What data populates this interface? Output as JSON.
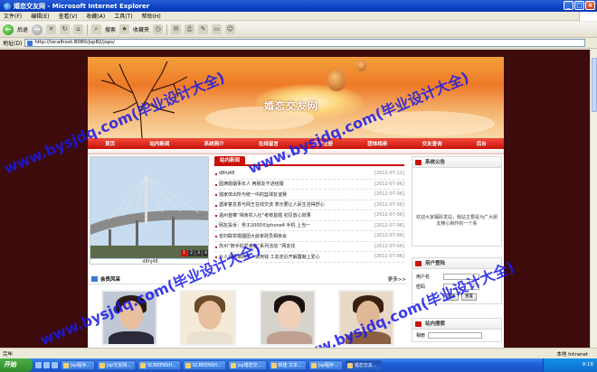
{
  "window": {
    "title": "婚恋交友网 - Microsoft Internet Explorer",
    "minimize": "_",
    "maximize": "□",
    "close": "×"
  },
  "menu": [
    "文件(F)",
    "编辑(E)",
    "查看(V)",
    "收藏(A)",
    "工具(T)",
    "帮助(H)"
  ],
  "toolbar": {
    "back_label": "后退",
    "search_label": "搜索",
    "favorites_label": "收藏夹"
  },
  "address": {
    "label": "地址(D)",
    "url": "http://localhost:8080/jsp82/jsps/"
  },
  "site": {
    "banner_title": "婚恋交友网",
    "nav": [
      "首页",
      "站内新闻",
      "系统简介",
      "在线留言",
      "用户注册",
      "团体相亲",
      "交友查询",
      "后台"
    ]
  },
  "photo": {
    "caption": "d8hj48",
    "pager": [
      "1",
      "2",
      "3",
      "4"
    ]
  },
  "news": {
    "title": "站内新闻",
    "items": [
      {
        "text": "d8hj48",
        "date": "[2012-07-11]"
      },
      {
        "text": "圆满婚姻事长人 两朋友不进结婚",
        "date": "[2012-07-06]"
      },
      {
        "text": "独家体出所与统一中的篮球友谊赛",
        "date": "[2012-07-06]"
      },
      {
        "text": "遇家宴息意与网王在线交流 表示要让人民生活得舒心",
        "date": "[2012-07-06]"
      },
      {
        "text": "温州首推“相亲农入社”考核首题 初见放心效果",
        "date": "[2012-07-06]"
      },
      {
        "text": "网友投诉：男子2000元iphone4 手机 上当一",
        "date": "[2012-07-06]"
      },
      {
        "text": "省妇联举婚姻团大龄家政员相亲会",
        "date": "[2012-07-06]"
      },
      {
        "text": "苏州“随手拍爱满家”系列活动 “网友找",
        "date": "[2012-07-06]"
      },
      {
        "text": "女人会跟谁的男人会用钱 工友走近开解露献上爱心",
        "date": "[2012-07-06]"
      }
    ]
  },
  "sidebar": {
    "notice_title": "系统公告",
    "notice_text": "欢迎大家踊跃发站，我站主要是为广大朋友精心制作的一个系",
    "login_title": "用户登陆",
    "username_label": "用户名",
    "password_label": "密码",
    "login_button": "登陆",
    "reset_button": "重置",
    "search_title": "站内搜索",
    "search_label": "相册"
  },
  "members": {
    "title": "会员风采",
    "more": "更多>>"
  },
  "watermark": {
    "text": "www.bysjdq.com(毕业设计大全)"
  },
  "status": {
    "left": "完毕",
    "zone": "本地 Intranet"
  },
  "taskbar": {
    "start": "开始",
    "tasks": [
      "Jsp程序...",
      "jsp交友网...",
      "SCREENSH...",
      "SCREENSH...",
      "jsp婚恋交...",
      "新建 文本...",
      "jsp程序...",
      "婚恋交友..."
    ],
    "clock": "9:18"
  }
}
